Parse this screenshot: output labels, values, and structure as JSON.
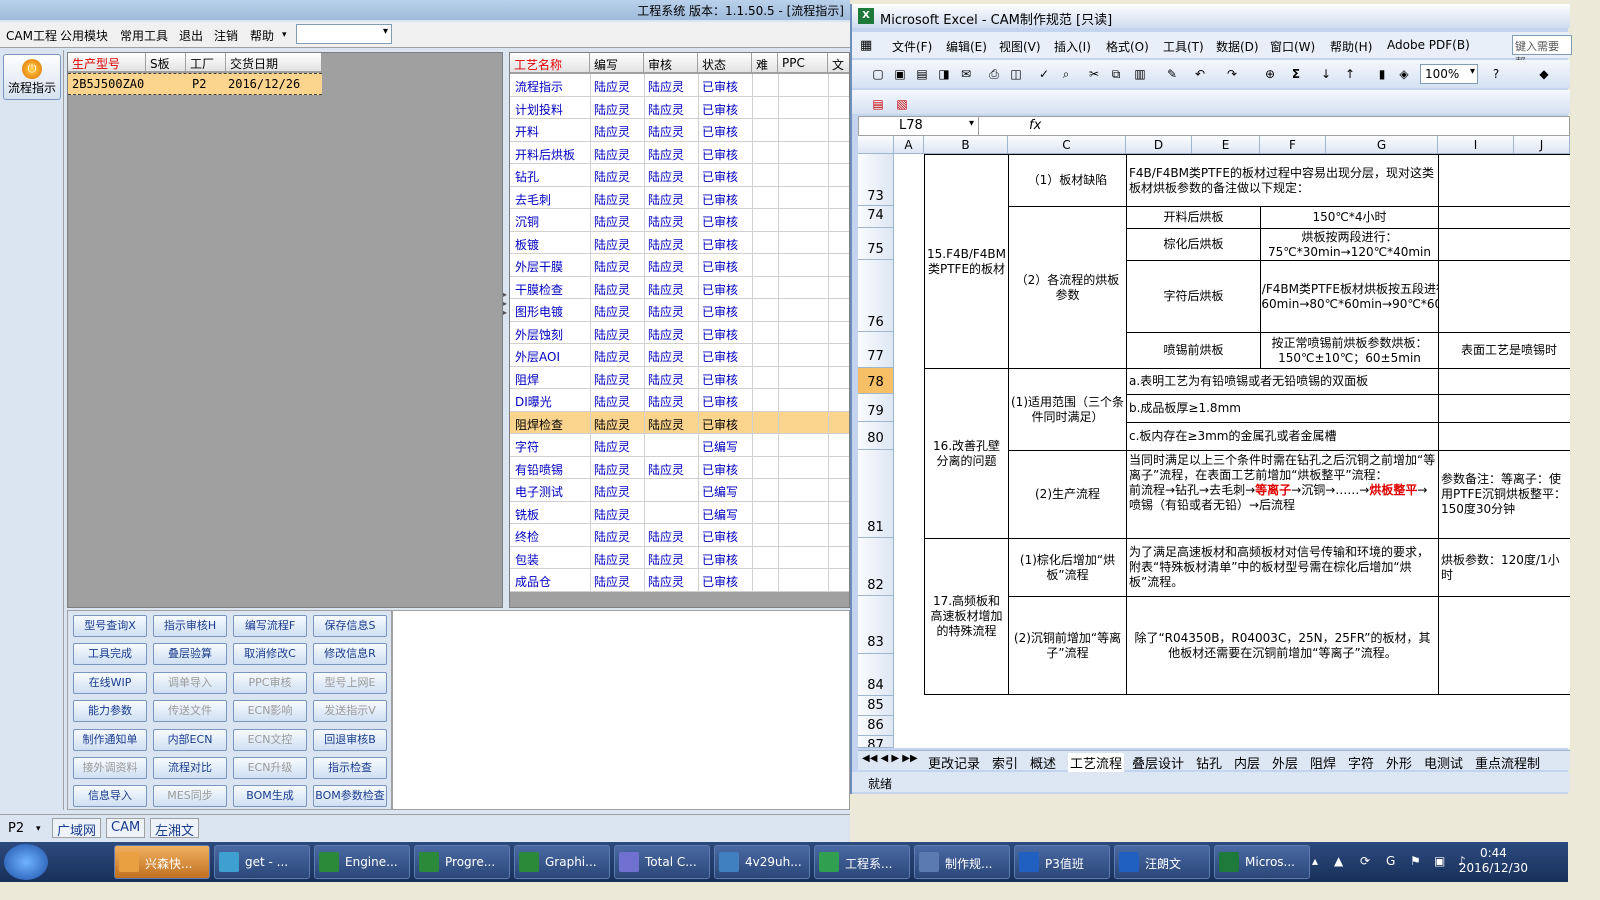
{
  "app": {
    "title": "工程系统  版本：1.1.50.5 - [流程指示]",
    "menu": [
      "CAM工程",
      "公用模块",
      "常用工具",
      "退出",
      "注销",
      "帮助"
    ],
    "flow_button": "流程指示",
    "grid1": {
      "headers": [
        "生产型号",
        "S板",
        "工厂",
        "交货日期"
      ],
      "row": [
        "2B5J500ZA0",
        "",
        "P2",
        "2016/12/26"
      ]
    },
    "grid2": {
      "headers": [
        "工艺名称",
        "编写",
        "审核",
        "状态",
        "难",
        "PPC",
        "文"
      ],
      "rows": [
        [
          "流程指示",
          "陆应灵",
          "陆应灵",
          "已审核"
        ],
        [
          "计划投料",
          "陆应灵",
          "陆应灵",
          "已审核"
        ],
        [
          "开料",
          "陆应灵",
          "陆应灵",
          "已审核"
        ],
        [
          "开料后烘板",
          "陆应灵",
          "陆应灵",
          "已审核"
        ],
        [
          "钻孔",
          "陆应灵",
          "陆应灵",
          "已审核"
        ],
        [
          "去毛刺",
          "陆应灵",
          "陆应灵",
          "已审核"
        ],
        [
          "沉铜",
          "陆应灵",
          "陆应灵",
          "已审核"
        ],
        [
          "板镀",
          "陆应灵",
          "陆应灵",
          "已审核"
        ],
        [
          "外层干膜",
          "陆应灵",
          "陆应灵",
          "已审核"
        ],
        [
          "干膜检查",
          "陆应灵",
          "陆应灵",
          "已审核"
        ],
        [
          "图形电镀",
          "陆应灵",
          "陆应灵",
          "已审核"
        ],
        [
          "外层蚀刻",
          "陆应灵",
          "陆应灵",
          "已审核"
        ],
        [
          "外层AOI",
          "陆应灵",
          "陆应灵",
          "已审核"
        ],
        [
          "阻焊",
          "陆应灵",
          "陆应灵",
          "已审核"
        ],
        [
          "DI曝光",
          "陆应灵",
          "陆应灵",
          "已审核"
        ],
        [
          "阻焊检查",
          "陆应灵",
          "陆应灵",
          "已审核"
        ],
        [
          "字符",
          "陆应灵",
          "",
          "已编写"
        ],
        [
          "有铅喷锡",
          "陆应灵",
          "陆应灵",
          "已审核"
        ],
        [
          "电子测试",
          "陆应灵",
          "",
          "已编写"
        ],
        [
          "铣板",
          "陆应灵",
          "",
          "已编写"
        ],
        [
          "终检",
          "陆应灵",
          "陆应灵",
          "已审核"
        ],
        [
          "包装",
          "陆应灵",
          "陆应灵",
          "已审核"
        ],
        [
          "成品仓",
          "陆应灵",
          "陆应灵",
          "已审核"
        ]
      ],
      "selected_index": 15
    },
    "buttons": [
      [
        "型号查询X",
        "指示审核H",
        "编写流程F",
        "保存信息S"
      ],
      [
        "工具完成",
        "叠层验算",
        "取消修改C",
        "修改信息R"
      ],
      [
        "在线WIP",
        "调单导入",
        "PPC审核",
        "型号上网E"
      ],
      [
        "能力参数",
        "传送文件",
        "ECN影响",
        "发送指示V"
      ],
      [
        "制作通知单",
        "内部ECN",
        "ECN文控",
        "回退审核B"
      ],
      [
        "接外调资料",
        "流程对比",
        "ECN升级",
        "指示检查"
      ],
      [
        "信息导入",
        "MES同步",
        "BOM生成",
        "BOM参数检查"
      ]
    ],
    "disabled_buttons": [
      "调单导入",
      "PPC审核",
      "型号上网E",
      "传送文件",
      "ECN影响",
      "发送指示V",
      "ECN文控",
      "接外调资料",
      "ECN升级",
      "MES同步"
    ],
    "status": {
      "factory": "P2",
      "tabs": [
        "广域网",
        "CAM",
        "左湘文"
      ]
    }
  },
  "excel": {
    "title": "Microsoft Excel - CAM制作规范 [只读]",
    "menu": [
      "文件(F)",
      "编辑(E)",
      "视图(V)",
      "插入(I)",
      "格式(O)",
      "工具(T)",
      "数据(D)",
      "窗口(W)",
      "帮助(H)",
      "Adobe PDF(B)"
    ],
    "help_placeholder": "键入需要帮",
    "zoom": "100%",
    "namebox": "L78",
    "fx": "fx",
    "columns": [
      "A",
      "B",
      "C",
      "D",
      "E",
      "F",
      "G",
      "I",
      "J"
    ],
    "rows": [
      "73",
      "74",
      "75",
      "76",
      "77",
      "78",
      "79",
      "80",
      "81",
      "82",
      "83",
      "84",
      "85",
      "86",
      "87"
    ],
    "selected_row": "78",
    "cells": {
      "b15": "15.F4B/F4BM类PTFE的板材",
      "c73": "（1）板材缺陷",
      "d73": "F4B/F4BM类PTFE的板材过程中容易出现分层，现对这类板材烘板参数的备注做以下规定：",
      "c74": "（2）各流程的烘板参数",
      "d74": "开料后烘板",
      "f74": "150℃*4小时",
      "d75": "棕化后烘板",
      "f75": "烘板按两段进行：75℃*30min→120℃*40min",
      "d76": "字符后烘板",
      "f76": "F4B/F4BM类PTFE板材烘板按五段进行：50℃*90min→70℃*60min→80℃*60min→90℃*60min→150℃*60min",
      "d77": "喷锡前烘板",
      "f77": "按正常喷锡前烘板参数烘板：150℃±10℃；60±5min",
      "g77": "表面工艺是喷锡时",
      "b16": "16.改善孔壁分离的问题",
      "c78": "(1)适用范围（三个条件同时满足）",
      "d78": "a.表明工艺为有铅喷锡或者无铅喷锡的双面板",
      "d79": "b.成品板厚≥1.8mm",
      "d80": "c.板内存在≥3mm的金属孔或者金属槽",
      "c81": "(2)生产流程",
      "d81a": "当同时满足以上三个条件时需在钻孔之后沉铜之前增加“等离子”流程，在表面工艺前增加“烘板整平”流程：",
      "d81b": "前流程→钻孔→去毛刺→",
      "d81c": "等离子",
      "d81d": "→沉铜→……→",
      "d81e": "烘板整平",
      "d81f": "→喷锡（有铅或者无铅）→后流程",
      "g81": "参数备注：等离子：使用PTFE沉铜烘板整平：150度30分钟",
      "b17": "17.高频板和高速板材增加的特殊流程",
      "c82": "(1)棕化后增加“烘板”流程",
      "d82": "为了满足高速板材和高频板材对信号传输和环境的要求，附表“特殊板材清单”中的板材型号需在棕化后增加“烘板”流程。",
      "g82": "烘板参数：120度/1小时",
      "c83": "(2)沉铜前增加“等离子”流程",
      "d83": "除了“R04350B，R04003C，25N，25FR”的板材，其他板材还需要在沉铜前增加“等离子”流程。"
    },
    "tabs": [
      "更改记录",
      "索引",
      "概述",
      "工艺流程",
      "叠层设计",
      "钻孔",
      "内层",
      "外层",
      "阻焊",
      "字符",
      "外形",
      "电测试",
      "重点流程制"
    ],
    "status": "就绪"
  },
  "taskbar": {
    "items": [
      "兴森快...",
      "get - ...",
      "Engine...",
      "Progre...",
      "Graphi...",
      "Total C...",
      "4v29uh...",
      "工程系...",
      "制作规...",
      "P3值班",
      "汪朗文",
      "Micros..."
    ],
    "time": "0:44",
    "date": "2016/12/30"
  },
  "colors": {
    "selected_row": "#fbd48e",
    "link_blue": "#0000c0",
    "header_red": "#e00000"
  }
}
